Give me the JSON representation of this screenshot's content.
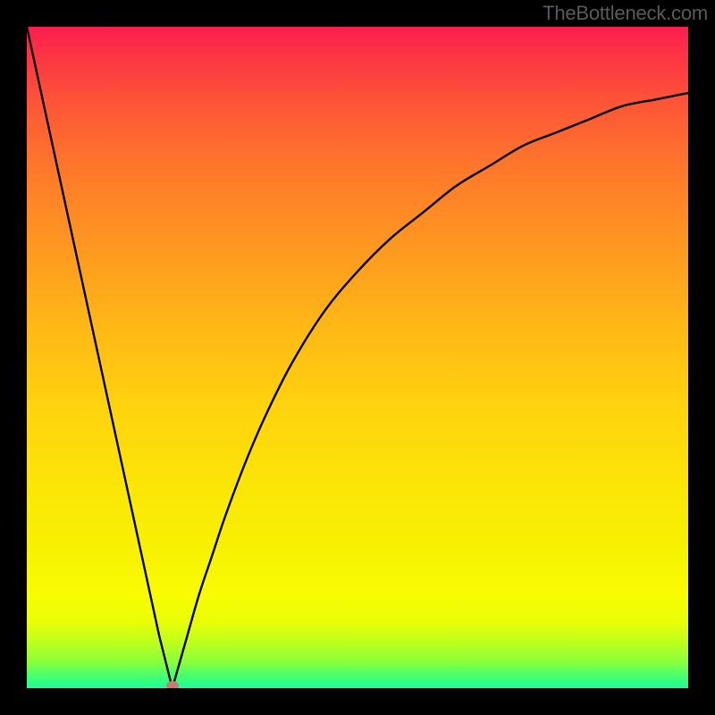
{
  "attribution": "TheBottleneck.com",
  "colors": {
    "frame": "#000000",
    "curve": "#000000",
    "marker": "#cb7a6d",
    "gradient_top": "#fb1c4f",
    "gradient_bottom": "#1aff98",
    "attribution_text": "#5a5a5a"
  },
  "chart_data": {
    "type": "line",
    "title": "",
    "xlabel": "",
    "ylabel": "",
    "xlim": [
      0,
      100
    ],
    "ylim": [
      0,
      100
    ],
    "min_point": {
      "x": 22,
      "y": 0
    },
    "series": [
      {
        "name": "bottleneck-curve",
        "x": [
          0,
          5,
          10,
          15,
          20,
          22,
          24,
          26,
          28,
          30,
          33,
          36,
          40,
          45,
          50,
          55,
          60,
          65,
          70,
          75,
          80,
          85,
          90,
          95,
          100
        ],
        "y": [
          100,
          77,
          54,
          31,
          8,
          0,
          7,
          14,
          20,
          26,
          34,
          41,
          49,
          57,
          63,
          68,
          72,
          76,
          79,
          82,
          84,
          86,
          88,
          89,
          90
        ]
      }
    ],
    "annotations": []
  }
}
